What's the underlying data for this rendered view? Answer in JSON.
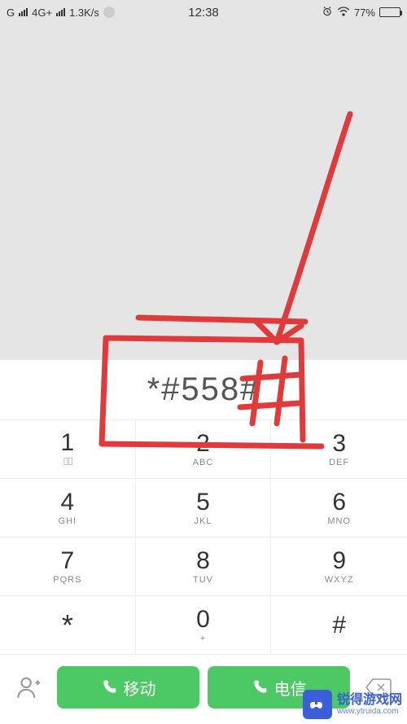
{
  "status_bar": {
    "network_type_g": "G",
    "network_type_4g": "4G+",
    "data_speed": "1.3K/s",
    "time": "12:38",
    "battery_percent": "77%",
    "battery_fill_pct": 77
  },
  "dialer": {
    "entered_number": "*#558#"
  },
  "keypad": [
    {
      "digit": "1",
      "sub": "voicemail"
    },
    {
      "digit": "2",
      "sub": "ABC"
    },
    {
      "digit": "3",
      "sub": "DEF"
    },
    {
      "digit": "4",
      "sub": "GHI"
    },
    {
      "digit": "5",
      "sub": "JKL"
    },
    {
      "digit": "6",
      "sub": "MNO"
    },
    {
      "digit": "7",
      "sub": "PQRS"
    },
    {
      "digit": "8",
      "sub": "TUV"
    },
    {
      "digit": "9",
      "sub": "WXYZ"
    },
    {
      "digit": "*",
      "sub": ""
    },
    {
      "digit": "0",
      "sub": "+"
    },
    {
      "digit": "#",
      "sub": ""
    }
  ],
  "bottom": {
    "call1_label": "移动",
    "call2_label": "电信"
  },
  "watermark": {
    "main": "锐得游戏网",
    "sub": "www.ytruida.com"
  }
}
